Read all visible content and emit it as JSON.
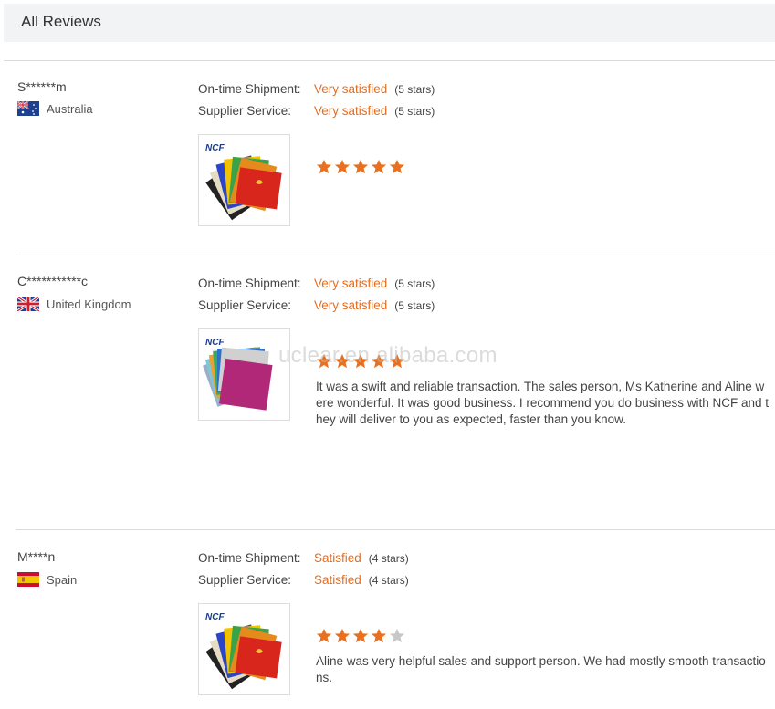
{
  "header": {
    "title": "All Reviews"
  },
  "watermark": "uclear.en.alibaba.com",
  "reviews": [
    {
      "buyer": "S******m",
      "country": "Australia",
      "flag": "australia-flag-icon",
      "shipment_label": "On-time Shipment:",
      "shipment_value": "Very satisfied",
      "shipment_stars": "(5 stars)",
      "service_label": "Supplier Service:",
      "service_value": "Very satisfied",
      "service_stars": "(5 stars)",
      "product_brand": "NCF",
      "rating": 5,
      "comment": ""
    },
    {
      "buyer": "C***********c",
      "country": "United Kingdom",
      "flag": "uk-flag-icon",
      "shipment_label": "On-time Shipment:",
      "shipment_value": "Very satisfied",
      "shipment_stars": "(5 stars)",
      "service_label": "Supplier Service:",
      "service_value": "Very satisfied",
      "service_stars": "(5 stars)",
      "product_brand": "NCF",
      "rating": 5,
      "comment": "It was a swift and reliable transaction. The sales person, Ms Katherine and Aline were wonderful. It was good business. I recommend you do business with NCF and they will deliver to you as expected, faster than you know."
    },
    {
      "buyer": "M****n",
      "country": "Spain",
      "flag": "spain-flag-icon",
      "shipment_label": "On-time Shipment:",
      "shipment_value": "Satisfied",
      "shipment_stars": "(4 stars)",
      "service_label": "Supplier Service:",
      "service_value": "Satisfied",
      "service_stars": "(4 stars)",
      "product_brand": "NCF",
      "rating": 4,
      "comment": "Aline was very helpful sales and support person. We had mostly smooth transactions."
    }
  ],
  "colors": {
    "accent": "#e56d1f",
    "star_on": "#e8701e",
    "star_off": "#c8c8c8"
  }
}
